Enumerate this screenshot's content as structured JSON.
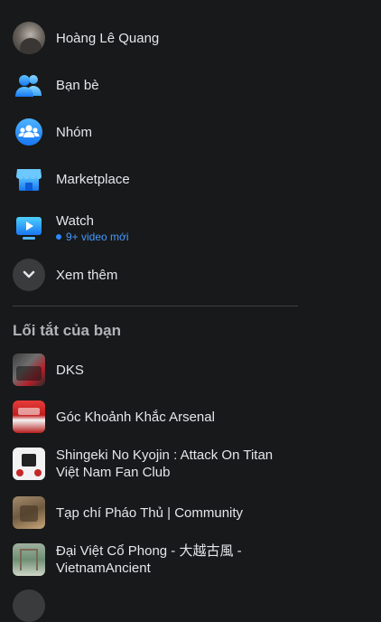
{
  "colors": {
    "background": "#18191a",
    "text_primary": "#e4e6eb",
    "text_secondary": "#b0b3b8",
    "accent_blue": "#2d88ff",
    "icon_bg": "#3a3b3c"
  },
  "menu": {
    "profile": {
      "label": "Hoàng Lê Quang"
    },
    "friends": {
      "label": "Bạn bè",
      "icon": "friends-icon"
    },
    "groups": {
      "label": "Nhóm",
      "icon": "groups-icon"
    },
    "marketplace": {
      "label": "Marketplace",
      "icon": "marketplace-icon"
    },
    "watch": {
      "label": "Watch",
      "sub": "9+ video mới",
      "icon": "watch-icon"
    },
    "see_more": {
      "label": "Xem thêm",
      "icon": "chevron-down-icon"
    }
  },
  "shortcuts": {
    "title": "Lối tắt của bạn",
    "items": [
      {
        "label": "DKS"
      },
      {
        "label": "Góc Khoảnh Khắc Arsenal"
      },
      {
        "line1": "Shingeki No Kyojin : Attack On Titan",
        "line2": "Việt Nam Fan Club"
      },
      {
        "label": "Tạp chí Pháo Thủ | Community"
      },
      {
        "line1": "Đại Việt Cổ Phong - 大越古風 -",
        "line2": "VietnamAncient"
      }
    ]
  }
}
